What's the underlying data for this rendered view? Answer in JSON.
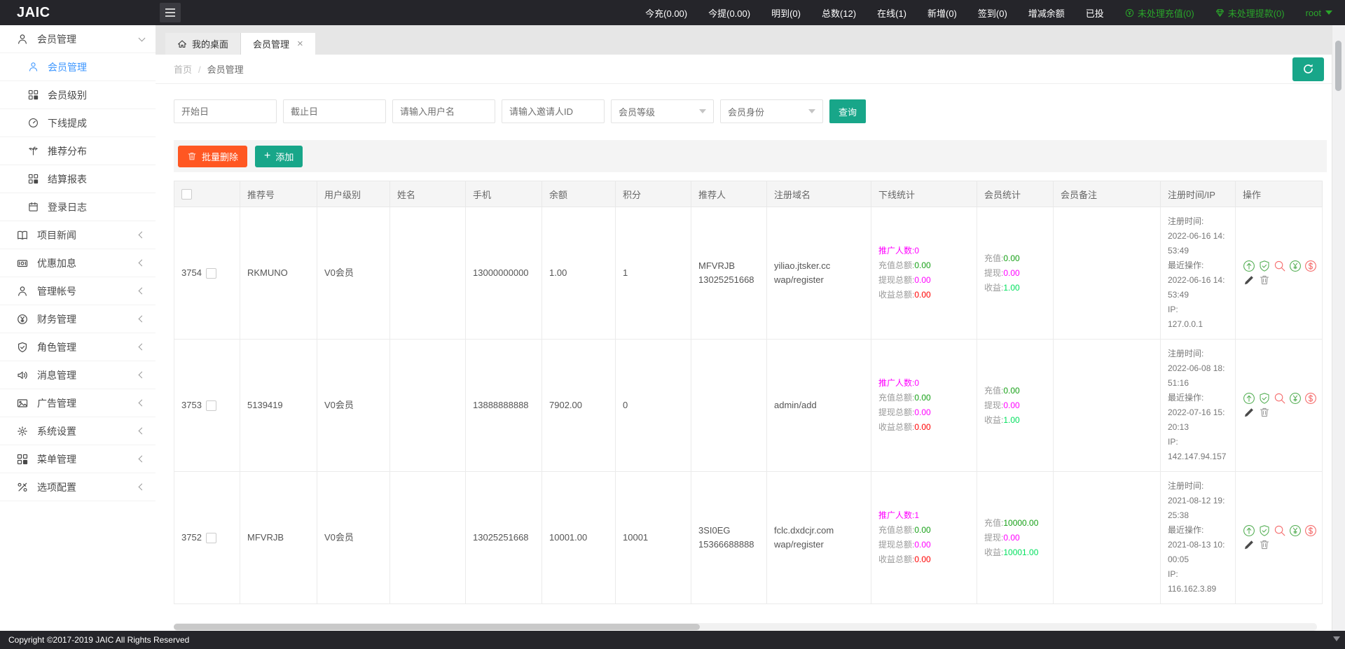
{
  "topbar": {
    "logo": "JAIC",
    "stats": [
      "今充(0.00)",
      "今提(0.00)",
      "明到(0)",
      "总数(12)",
      "在线(1)",
      "新增(0)",
      "签到(0)",
      "增减余额",
      "已投"
    ],
    "pending": [
      {
        "label": "未处理充值(0)",
        "icon": "coin-icon"
      },
      {
        "label": "未处理提款(0)",
        "icon": "gem-icon"
      }
    ],
    "user": "root",
    "accent_green": "#2aa52a"
  },
  "sidebar": {
    "items": [
      {
        "label": "会员管理",
        "icon": "user-icon",
        "expanded": true,
        "children": [
          {
            "label": "会员管理",
            "icon": "user-icon",
            "active": true
          },
          {
            "label": "会员级别",
            "icon": "grid-dot-icon"
          },
          {
            "label": "下线提成",
            "icon": "gauge-icon"
          },
          {
            "label": "推荐分布",
            "icon": "tree-icon"
          },
          {
            "label": "结算报表",
            "icon": "grid-dot-icon"
          },
          {
            "label": "登录日志",
            "icon": "calendar-icon"
          }
        ]
      },
      {
        "label": "项目新闻",
        "icon": "book-icon"
      },
      {
        "label": "优惠加息",
        "icon": "banknote-icon"
      },
      {
        "label": "管理帐号",
        "icon": "user-icon"
      },
      {
        "label": "财务管理",
        "icon": "yen-icon"
      },
      {
        "label": "角色管理",
        "icon": "shield-icon"
      },
      {
        "label": "消息管理",
        "icon": "speaker-icon"
      },
      {
        "label": "广告管理",
        "icon": "image-icon"
      },
      {
        "label": "系统设置",
        "icon": "gear-icon"
      },
      {
        "label": "菜单管理",
        "icon": "grid-dot-icon"
      },
      {
        "label": "选项配置",
        "icon": "tools-icon"
      }
    ]
  },
  "tabs": [
    {
      "label": "我的桌面",
      "icon": "home-icon",
      "active": false
    },
    {
      "label": "会员管理",
      "active": true,
      "closable": true
    }
  ],
  "breadcrumb": [
    "首页",
    "会员管理"
  ],
  "filters": {
    "inputs": [
      "开始日",
      "截止日",
      "请输入用户名",
      "请输入邀请人ID"
    ],
    "selects": [
      "会员等级",
      "会员身份"
    ],
    "query_label": "查询"
  },
  "actions": {
    "batch_delete": "批量删除",
    "add": "添加"
  },
  "table": {
    "headers": [
      "推荐号",
      "用户级别",
      "姓名",
      "手机",
      "余额",
      "积分",
      "推荐人",
      "注册域名",
      "下线统计",
      "会员统计",
      "会员备注",
      "注册时间/IP",
      "操作"
    ],
    "stat_labels": {
      "promo": "推广人数:",
      "recharge_total": "充值总额:",
      "withdraw_total": "提现总额:",
      "income_total": "收益总额:",
      "recharge": "充值:",
      "withdraw": "提现:",
      "income": "收益:"
    },
    "reg_labels": {
      "reg": "注册时间:",
      "last": "最近操作:",
      "ip": "IP:"
    },
    "op_icons": [
      "up-circle-icon",
      "shield-check-icon",
      "magnifier-icon",
      "yen-circle-icon",
      "dollar-circle-icon",
      "edit-pencil-icon",
      "trash-icon"
    ],
    "rows": [
      {
        "id": "3754",
        "ref_no": "RKMUNO",
        "level": "V0会员",
        "name": "",
        "phone": "13000000000",
        "balance": "1.00",
        "points": "1",
        "referrer": [
          "MFVRJB",
          "13025251668"
        ],
        "domain": [
          "yiliao.jtsker.cc",
          "wap/register"
        ],
        "downline": {
          "promo": "0",
          "recharge_total": "0.00",
          "withdraw_total": "0.00",
          "income_total": "0.00"
        },
        "member": {
          "recharge": "0.00",
          "withdraw": "0.00",
          "income": "1.00"
        },
        "remark": "",
        "reg_time": "2022-06-16 14:53:49",
        "last_op": "2022-06-16 14:53:49",
        "ip": "127.0.0.1"
      },
      {
        "id": "3753",
        "ref_no": "5139419",
        "level": "V0会员",
        "name": "",
        "phone": "13888888888",
        "balance": "7902.00",
        "points": "0",
        "referrer": [],
        "domain": [
          "admin/add"
        ],
        "downline": {
          "promo": "0",
          "recharge_total": "0.00",
          "withdraw_total": "0.00",
          "income_total": "0.00"
        },
        "member": {
          "recharge": "0.00",
          "withdraw": "0.00",
          "income": "1.00"
        },
        "remark": "",
        "reg_time": "2022-06-08 18:51:16",
        "last_op": "2022-07-16 15:20:13",
        "ip": "142.147.94.157"
      },
      {
        "id": "3752",
        "ref_no": "MFVRJB",
        "level": "V0会员",
        "name": "",
        "phone": "13025251668",
        "balance": "10001.00",
        "points": "10001",
        "referrer": [
          "3SI0EG",
          "15366688888"
        ],
        "domain": [
          "fclc.dxdcjr.com",
          "wap/register"
        ],
        "downline": {
          "promo": "1",
          "recharge_total": "0.00",
          "withdraw_total": "0.00",
          "income_total": "0.00"
        },
        "member": {
          "recharge": "10000.00",
          "withdraw": "0.00",
          "income": "10001.00"
        },
        "remark": "",
        "reg_time": "2021-08-12 19:25:38",
        "last_op": "2021-08-13 10:00:05",
        "ip": "116.162.3.89"
      }
    ]
  },
  "footer": {
    "copyright": "Copyright ©2017-2019 JAIC All Rights Reserved"
  },
  "colors": {
    "header_bg": "#25252a",
    "accent_teal": "#18a689",
    "danger_orange": "#ff5722",
    "green_value": "#16a016",
    "magenta_value": "#ff00ff",
    "red_value": "#ff0000",
    "bright_green_value": "#00e05d",
    "active_link_blue": "#3e97ff"
  }
}
